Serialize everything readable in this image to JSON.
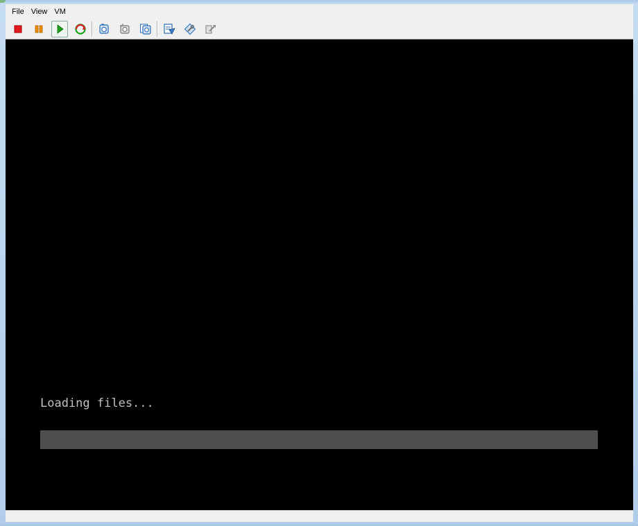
{
  "menubar": {
    "items": [
      {
        "label": "File"
      },
      {
        "label": "View"
      },
      {
        "label": "VM"
      }
    ]
  },
  "toolbar": {
    "buttons": [
      {
        "icon": "stop-icon",
        "color": "#e41b1b"
      },
      {
        "icon": "pause-icon",
        "color": "#f08c00"
      },
      {
        "icon": "play-icon",
        "color": "#1aa31a"
      },
      {
        "icon": "reset-icon",
        "color": "#d42020"
      },
      {
        "icon": "snapshot-icon",
        "color": "#2a6db5"
      },
      {
        "icon": "revert-snapshot-icon",
        "color": "#8a8a8a"
      },
      {
        "icon": "manage-snapshots-icon",
        "color": "#2a6db5"
      },
      {
        "icon": "vm-settings-icon",
        "color": "#2a6db5"
      },
      {
        "icon": "vm-tools-icon",
        "color": "#3a7cc4"
      },
      {
        "icon": "send-keys-icon",
        "color": "#8a8a8a"
      }
    ]
  },
  "console": {
    "status_text": "Loading files...",
    "progress": 0,
    "background": "#000000",
    "text_color": "#c0c0c0",
    "progress_track_color": "#4e4e4e"
  }
}
